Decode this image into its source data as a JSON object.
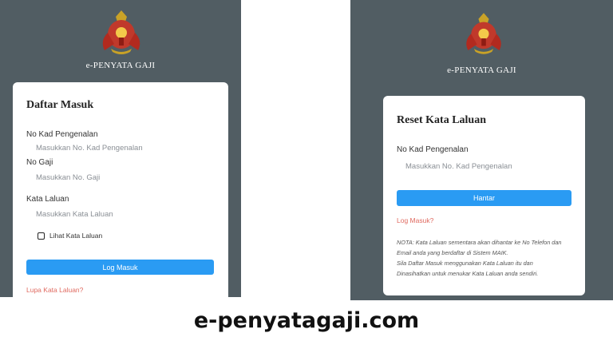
{
  "left": {
    "brand": "e-PENYATA GAJI",
    "title": "Daftar Masuk",
    "fields": [
      {
        "label": "No Kad Pengenalan",
        "placeholder": "Masukkan No. Kad Pengenalan"
      },
      {
        "label": "No Gaji",
        "placeholder": "Masukkan No. Gaji"
      },
      {
        "label": "Kata Laluan",
        "placeholder": "Masukkan Kata Laluan"
      }
    ],
    "show_password_label": "Lihat Kata Laluan",
    "submit_label": "Log Masuk",
    "forgot_link": "Lupa Kata Laluan?"
  },
  "right": {
    "brand": "e-PENYATA GAJI",
    "title": "Reset Kata Laluan",
    "field": {
      "label": "No Kad Pengenalan",
      "placeholder": "Masukkan No. Kad Pengenalan"
    },
    "submit_label": "Hantar",
    "login_link": "Log Masuk?",
    "note_lines": [
      "NOTA: Kata Laluan sementara akan dihantar ke No Telefon dan",
      "Email anda yang berdaftar di Sistem MAIK.",
      "Sila Daftar Masuk menggunakan Kata Laluan itu dan",
      "Dinasihatkan untuk menukar Kata Laluan anda sendiri."
    ]
  },
  "caption": "e-penyatagaji.com",
  "colors": {
    "panel_bg": "#515d63",
    "button": "#2a9bf3",
    "link": "#e06a60"
  }
}
